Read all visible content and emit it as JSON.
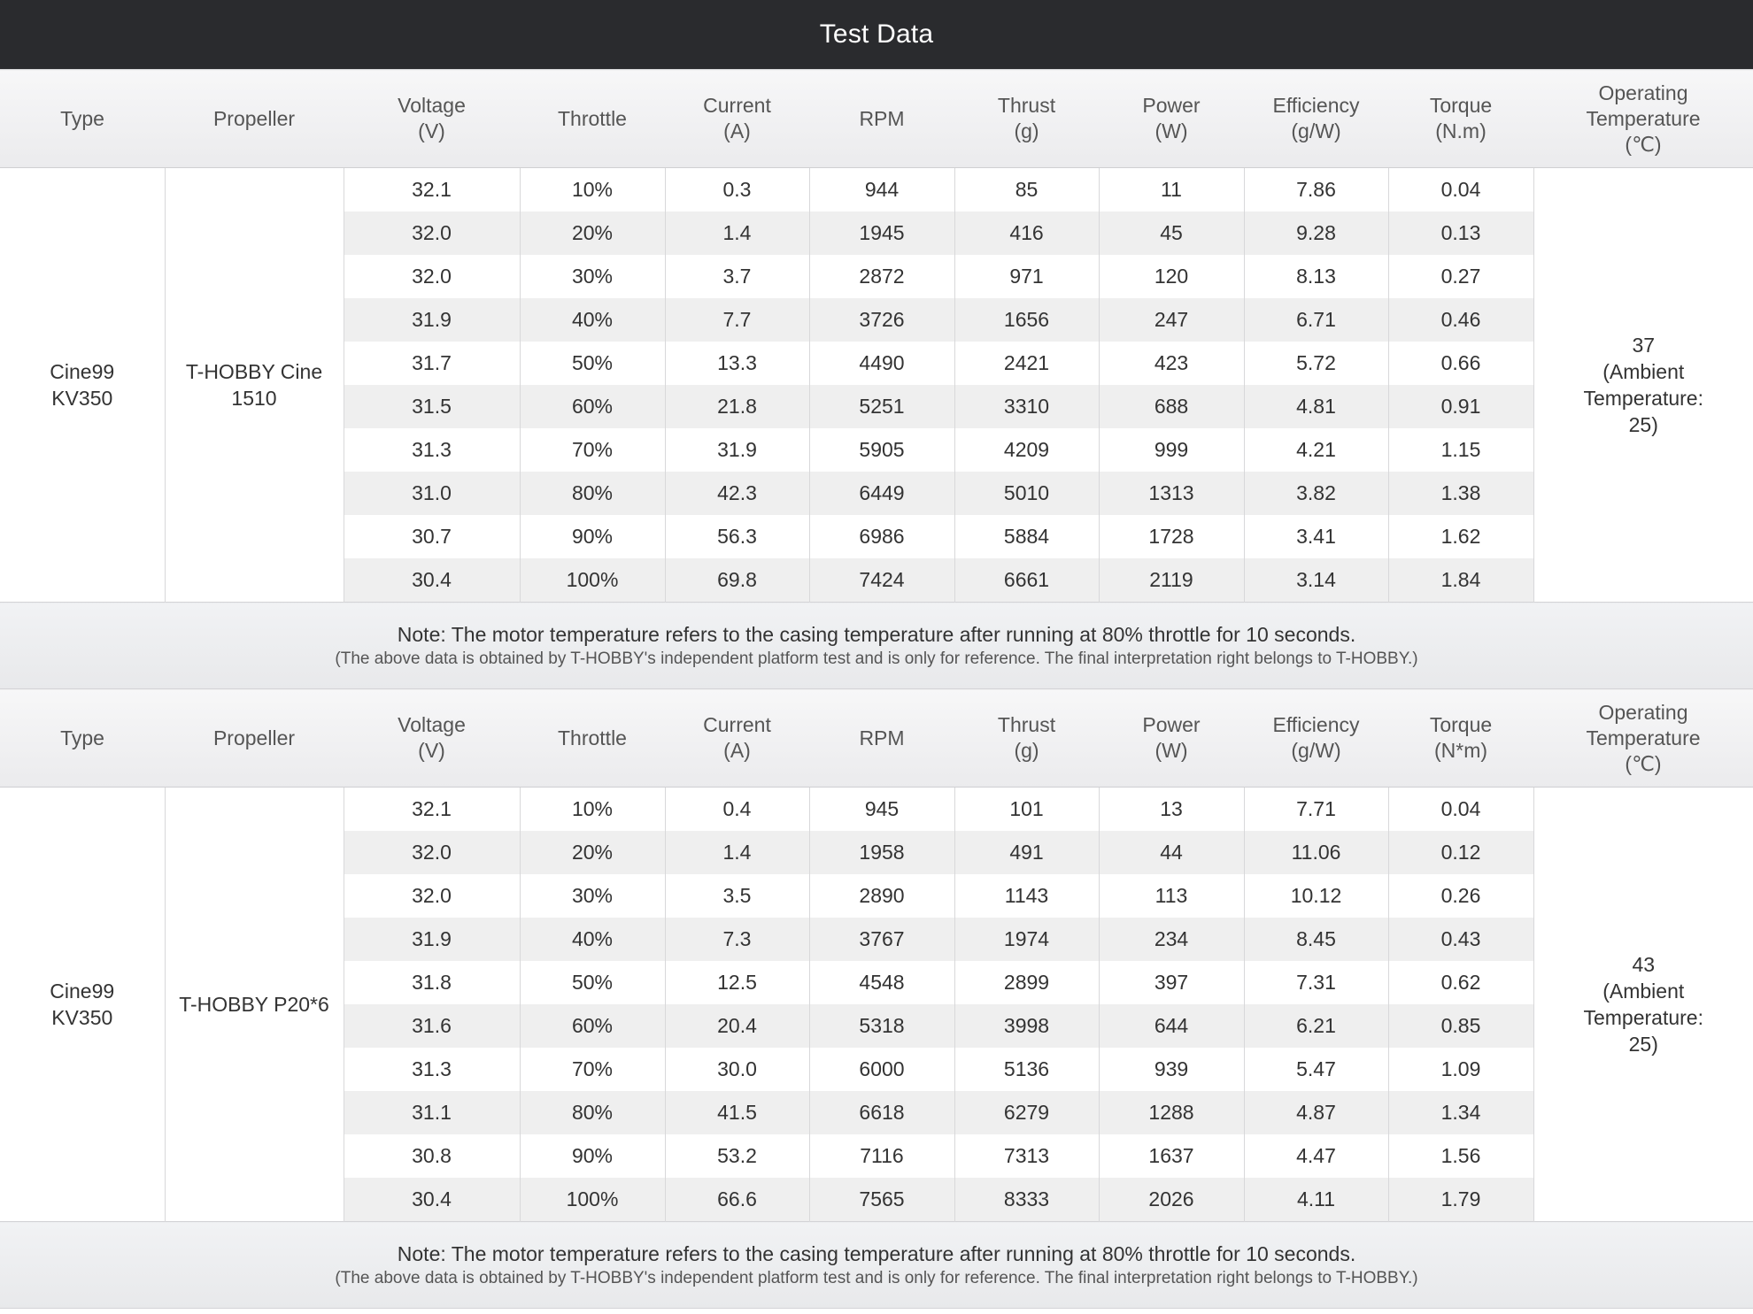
{
  "title": "Test Data",
  "headers_1": {
    "type": "Type",
    "propeller": "Propeller",
    "voltage": [
      "Voltage",
      "(V)"
    ],
    "throttle": "Throttle",
    "current": [
      "Current",
      "(A)"
    ],
    "rpm": "RPM",
    "thrust": [
      "Thrust",
      "(g)"
    ],
    "power": [
      "Power",
      "(W)"
    ],
    "efficiency": [
      "Efficiency",
      "(g/W)"
    ],
    "torque": [
      "Torque",
      "(N.m)"
    ],
    "temperature": [
      "Operating",
      "Temperature",
      "(℃)"
    ]
  },
  "headers_2": {
    "type": "Type",
    "propeller": "Propeller",
    "voltage": [
      "Voltage",
      "(V)"
    ],
    "throttle": "Throttle",
    "current": [
      "Current",
      "(A)"
    ],
    "rpm": "RPM",
    "thrust": [
      "Thrust",
      "(g)"
    ],
    "power": [
      "Power",
      "(W)"
    ],
    "efficiency": [
      "Efficiency",
      "(g/W)"
    ],
    "torque": [
      "Torque",
      "(N*m)"
    ],
    "temperature": [
      "Operating",
      "Temperature",
      "(℃)"
    ]
  },
  "tables": [
    {
      "type_lines": [
        "Cine99",
        "KV350"
      ],
      "propeller_lines": [
        "T-HOBBY Cine",
        "1510"
      ],
      "temperature_lines": [
        "37",
        "(Ambient",
        "Temperature:",
        "25)"
      ],
      "rows": [
        [
          "32.1",
          "10%",
          "0.3",
          "944",
          "85",
          "11",
          "7.86",
          "0.04"
        ],
        [
          "32.0",
          "20%",
          "1.4",
          "1945",
          "416",
          "45",
          "9.28",
          "0.13"
        ],
        [
          "32.0",
          "30%",
          "3.7",
          "2872",
          "971",
          "120",
          "8.13",
          "0.27"
        ],
        [
          "31.9",
          "40%",
          "7.7",
          "3726",
          "1656",
          "247",
          "6.71",
          "0.46"
        ],
        [
          "31.7",
          "50%",
          "13.3",
          "4490",
          "2421",
          "423",
          "5.72",
          "0.66"
        ],
        [
          "31.5",
          "60%",
          "21.8",
          "5251",
          "3310",
          "688",
          "4.81",
          "0.91"
        ],
        [
          "31.3",
          "70%",
          "31.9",
          "5905",
          "4209",
          "999",
          "4.21",
          "1.15"
        ],
        [
          "31.0",
          "80%",
          "42.3",
          "6449",
          "5010",
          "1313",
          "3.82",
          "1.38"
        ],
        [
          "30.7",
          "90%",
          "56.3",
          "6986",
          "5884",
          "1728",
          "3.41",
          "1.62"
        ],
        [
          "30.4",
          "100%",
          "69.8",
          "7424",
          "6661",
          "2119",
          "3.14",
          "1.84"
        ]
      ],
      "note": "Note: The motor temperature refers to the casing temperature after running at 80% throttle for 10 seconds.",
      "disclaimer": "(The above data is obtained by T-HOBBY's independent platform test and is only for reference. The final interpretation right belongs to T-HOBBY.)"
    },
    {
      "type_lines": [
        "Cine99",
        "KV350"
      ],
      "propeller_lines": [
        "T-HOBBY P20*6"
      ],
      "temperature_lines": [
        "43",
        "(Ambient",
        "Temperature:",
        "25)"
      ],
      "rows": [
        [
          "32.1",
          "10%",
          "0.4",
          "945",
          "101",
          "13",
          "7.71",
          "0.04"
        ],
        [
          "32.0",
          "20%",
          "1.4",
          "1958",
          "491",
          "44",
          "11.06",
          "0.12"
        ],
        [
          "32.0",
          "30%",
          "3.5",
          "2890",
          "1143",
          "113",
          "10.12",
          "0.26"
        ],
        [
          "31.9",
          "40%",
          "7.3",
          "3767",
          "1974",
          "234",
          "8.45",
          "0.43"
        ],
        [
          "31.8",
          "50%",
          "12.5",
          "4548",
          "2899",
          "397",
          "7.31",
          "0.62"
        ],
        [
          "31.6",
          "60%",
          "20.4",
          "5318",
          "3998",
          "644",
          "6.21",
          "0.85"
        ],
        [
          "31.3",
          "70%",
          "30.0",
          "6000",
          "5136",
          "939",
          "5.47",
          "1.09"
        ],
        [
          "31.1",
          "80%",
          "41.5",
          "6618",
          "6279",
          "1288",
          "4.87",
          "1.34"
        ],
        [
          "30.8",
          "90%",
          "53.2",
          "7116",
          "7313",
          "1637",
          "4.47",
          "1.56"
        ],
        [
          "30.4",
          "100%",
          "66.6",
          "7565",
          "8333",
          "2026",
          "4.11",
          "1.79"
        ]
      ],
      "note": "Note: The motor temperature refers to the casing temperature after running at 80% throttle for 10 seconds.",
      "disclaimer": "(The above data is obtained by T-HOBBY's independent platform test and is only for reference. The final interpretation right belongs to T-HOBBY.)"
    }
  ]
}
